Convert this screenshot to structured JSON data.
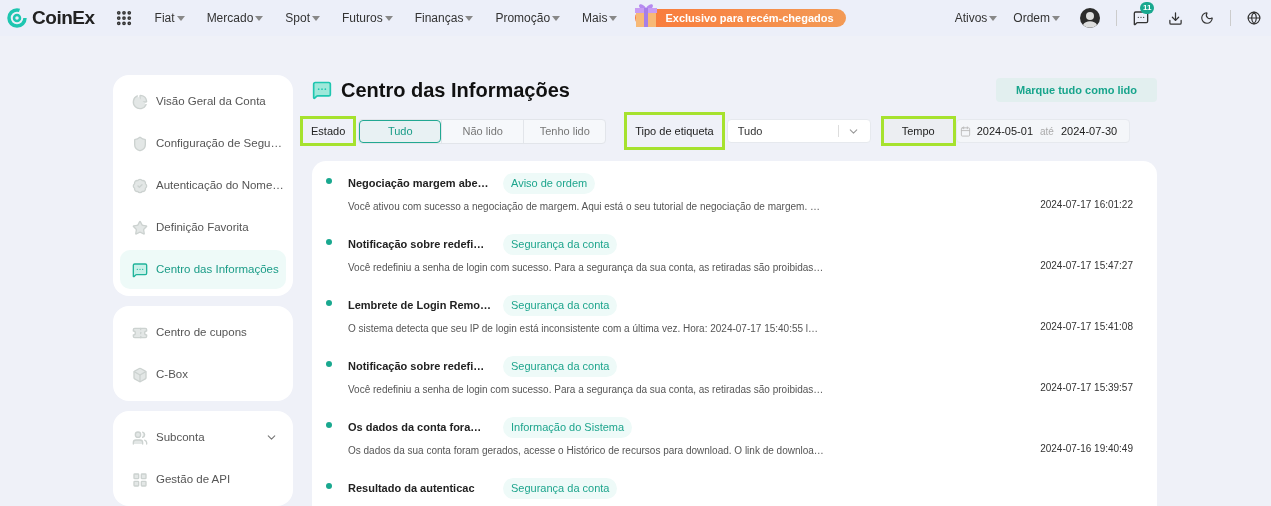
{
  "header": {
    "logo": "CoinEx",
    "nav": [
      {
        "label": "Fiat"
      },
      {
        "label": "Mercado"
      },
      {
        "label": "Spot"
      },
      {
        "label": "Futuros"
      },
      {
        "label": "Finanças"
      },
      {
        "label": "Promoção"
      },
      {
        "label": "Mais"
      }
    ],
    "promo": "Exclusivo para recém-chegados",
    "right_menus": [
      {
        "label": "Ativos"
      },
      {
        "label": "Ordem"
      }
    ],
    "notification_count": "11"
  },
  "sidebar": {
    "groups": [
      {
        "items": [
          {
            "label": "Visão Geral da Conta",
            "selected": false
          },
          {
            "label": "Configuração de Segu…",
            "selected": false
          },
          {
            "label": "Autenticação do Nome…",
            "selected": false
          },
          {
            "label": "Definição Favorita",
            "selected": false
          },
          {
            "label": "Centro das Informações",
            "selected": true
          }
        ]
      },
      {
        "items": [
          {
            "label": "Centro de cupons",
            "selected": false
          },
          {
            "label": "C-Box",
            "selected": false
          }
        ]
      },
      {
        "items": [
          {
            "label": "Subconta",
            "selected": false,
            "expanded": false
          },
          {
            "label": "Gestão de API",
            "selected": false
          }
        ]
      }
    ]
  },
  "page": {
    "title": "Centro das Informações",
    "mark_all_button": "Marque tudo como lido"
  },
  "status_filter": {
    "label": "Estado",
    "highlighted": true,
    "options": [
      {
        "label": "Tudo",
        "selected": true
      },
      {
        "label": "Não lido",
        "selected": false
      },
      {
        "label": "Tenho lido",
        "selected": false
      }
    ]
  },
  "tag_filter": {
    "label": "Tipo de etiqueta",
    "highlighted": true,
    "value": "Tudo"
  },
  "time_filter": {
    "label": "Tempo",
    "highlighted": true,
    "start": "2024-05-01",
    "separator": "até",
    "end": "2024-07-30"
  },
  "messages": [
    {
      "title": "Negociação margem abe…",
      "tag": "Aviso de ordem",
      "text": "Você ativou com sucesso a negociação de margem. Aqui está o seu tutorial de negociação de margem. …",
      "time": "2024-07-17 16:01:22",
      "unread": true
    },
    {
      "title": "Notificação sobre redefi…",
      "tag": "Segurança da conta",
      "text": "Você redefiniu a senha de login com sucesso. Para a segurança da sua conta, as retiradas são proibidas…",
      "time": "2024-07-17 15:47:27",
      "unread": true
    },
    {
      "title": "Lembrete de Login Remo…",
      "tag": "Segurança da conta",
      "text": "O sistema detecta que seu IP de login está inconsistente com a última vez. Hora:  2024-07-17 15:40:55 l…",
      "time": "2024-07-17 15:41:08",
      "unread": true
    },
    {
      "title": "Notificação sobre redefi…",
      "tag": "Segurança da conta",
      "text": "Você redefiniu a senha de login com sucesso. Para a segurança da sua conta, as retiradas são proibidas…",
      "time": "2024-07-17 15:39:57",
      "unread": true
    },
    {
      "title": "Os dados da conta fora…",
      "tag": "Informação do Sistema",
      "text": "Os dados da sua conta foram gerados, acesse o Histórico de recursos para download. O link de downloa…",
      "time": "2024-07-16 19:40:49",
      "unread": true
    },
    {
      "title": "Resultado da autenticac",
      "tag": "Segurança da conta",
      "unread": true
    }
  ]
}
